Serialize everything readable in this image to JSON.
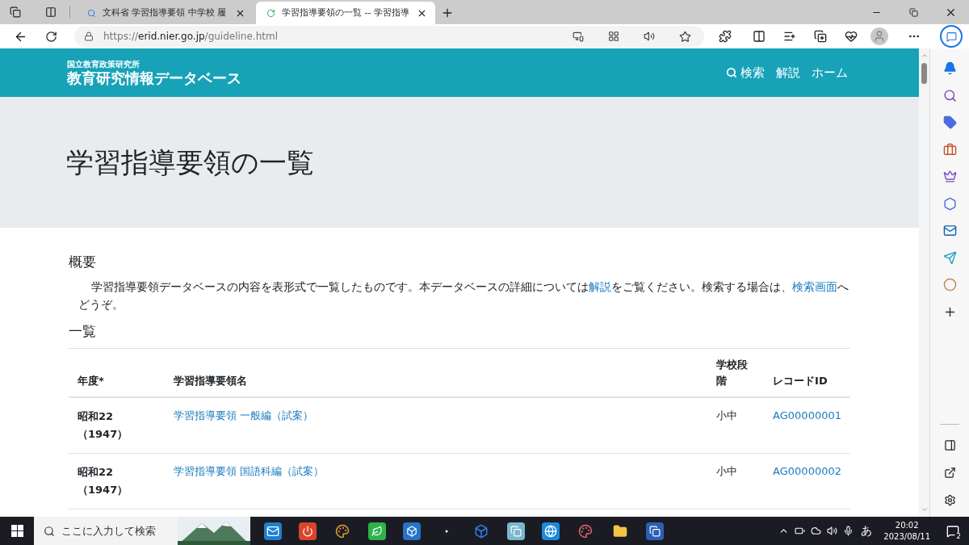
{
  "browser": {
    "tabs": [
      {
        "title": "文科省 学習指導要領 中学校 履",
        "kind": "search",
        "selected": false
      },
      {
        "title": "学習指導要領の一覧 -- 学習指導",
        "kind": "site",
        "selected": true
      }
    ],
    "url_scheme": "https://",
    "url_host": "erid.nier.go.jp",
    "url_path": "/guideline.html"
  },
  "header": {
    "org": "国立教育政策研究所",
    "logo": "教育研究情報データベース",
    "nav": [
      {
        "label": "検索",
        "kind": "search"
      },
      {
        "label": "解説",
        "kind": "plain"
      },
      {
        "label": "ホーム",
        "kind": "plain"
      }
    ]
  },
  "page_title": "学習指導要領の一覧",
  "overview": {
    "heading": "概要",
    "text_1": "学習指導要領データベースの内容を表形式で一覧したものです。本データベースの詳細については",
    "link_1": "解説",
    "text_2": "をご覧ください。検索する場合は、",
    "link_2": "検索画面",
    "text_3": "へどうぞ。"
  },
  "list": {
    "heading": "一覧",
    "columns": [
      "年度*",
      "学習指導要領名",
      "学校段階",
      "レコードID"
    ],
    "rows": [
      {
        "year": "昭和22",
        "year_ad": "（1947）",
        "name": "学習指導要領 一般編（試案）",
        "level": "小中",
        "record_id": "AG00000001"
      },
      {
        "year": "昭和22",
        "year_ad": "（1947）",
        "name": "学習指導要領 国語科編（試案）",
        "level": "小中",
        "record_id": "AG00000002"
      }
    ]
  },
  "taskbar": {
    "search_placeholder": "ここに入力して検索",
    "ime": "あ",
    "time": "20:02",
    "date": "2023/08/11",
    "notifications": "2"
  }
}
